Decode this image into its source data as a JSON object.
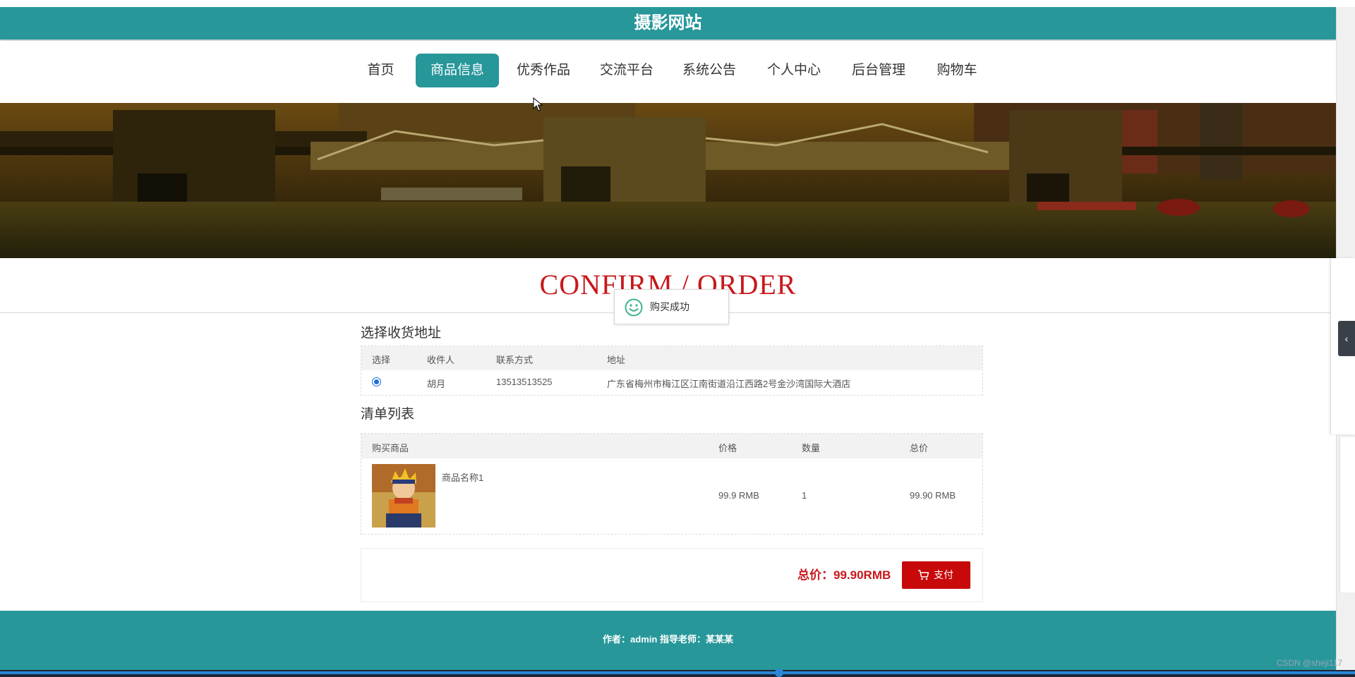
{
  "site": {
    "title": "摄影网站"
  },
  "nav": {
    "items": [
      {
        "label": "首页",
        "active": false
      },
      {
        "label": "商品信息",
        "active": true
      },
      {
        "label": "优秀作品",
        "active": false
      },
      {
        "label": "交流平台",
        "active": false
      },
      {
        "label": "系统公告",
        "active": false
      },
      {
        "label": "个人中心",
        "active": false
      },
      {
        "label": "后台管理",
        "active": false
      },
      {
        "label": "购物车",
        "active": false
      }
    ]
  },
  "page": {
    "heading": "CONFIRM / ORDER"
  },
  "toast": {
    "message": "购买成功",
    "icon": "smile-icon"
  },
  "address_section": {
    "title": "选择收货地址",
    "headers": [
      "选择",
      "收件人",
      "联系方式",
      "地址"
    ],
    "rows": [
      {
        "selected": true,
        "recipient": "胡月",
        "phone": "13513513525",
        "address": "广东省梅州市梅江区江南街道沿江西路2号金沙湾国际大酒店"
      }
    ]
  },
  "list_section": {
    "title": "清单列表",
    "headers": [
      "购买商品",
      "价格",
      "数量",
      "总价"
    ],
    "rows": [
      {
        "name": "商品名称1",
        "price": "99.9 RMB",
        "quantity": "1",
        "total": "99.90 RMB"
      }
    ]
  },
  "summary": {
    "total_label": "总价：99.90RMB",
    "pay_label": "支付"
  },
  "footer": {
    "text": "作者：admin 指导老师：某某某"
  },
  "watermark": "CSDN @sheji117",
  "colors": {
    "primary": "#27979a",
    "accent_red": "#c8181c",
    "pay_button": "#c8090a"
  }
}
